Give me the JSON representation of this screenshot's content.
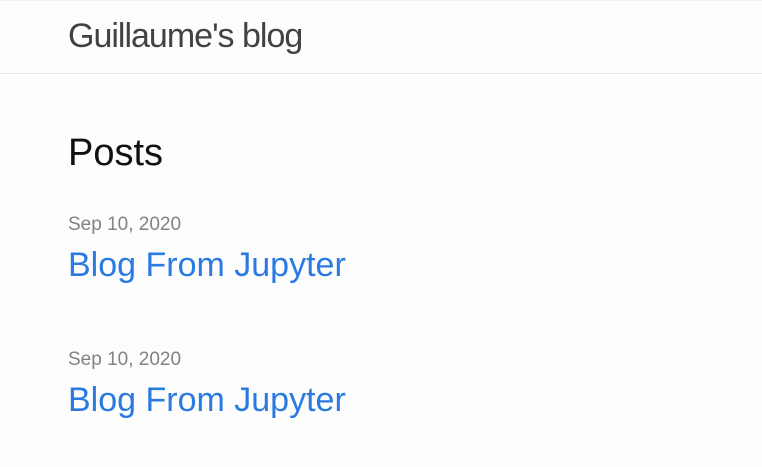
{
  "site": {
    "title": "Guillaume's blog"
  },
  "main": {
    "heading": "Posts",
    "posts": [
      {
        "date": "Sep 10, 2020",
        "title": "Blog From Jupyter"
      },
      {
        "date": "Sep 10, 2020",
        "title": "Blog From Jupyter"
      }
    ]
  },
  "colors": {
    "link": "#2a7ae2",
    "meta": "#828282",
    "title": "#424242",
    "background": "#fdfdfd"
  }
}
